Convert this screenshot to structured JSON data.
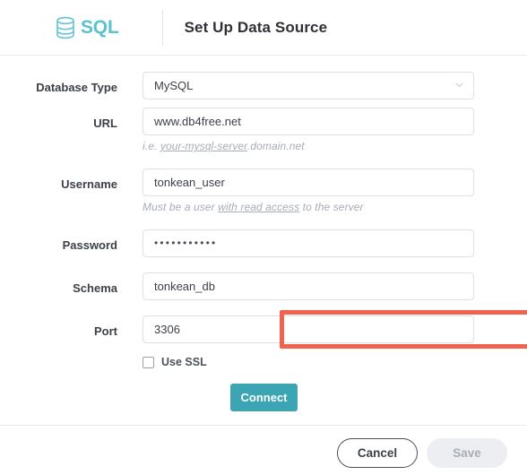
{
  "header": {
    "logo_text": "SQL",
    "logo_icon": "database-cylinder-icon",
    "title": "Set Up Data Source"
  },
  "form": {
    "fields": [
      {
        "label": "Database Type",
        "type": "select",
        "value": "MySQL",
        "icon": "chevron-down-icon",
        "hint": null,
        "highlighted": false
      },
      {
        "label": "URL",
        "type": "text",
        "value": "www.db4free.net",
        "hint_prefix": "i.e. ",
        "hint_underlined": "your-mysql-server",
        "hint_suffix": ".domain.net",
        "highlighted": false
      },
      {
        "label": "Username",
        "type": "text",
        "value": "tonkean_user",
        "hint_prefix": "Must be a user ",
        "hint_underlined": "with read access",
        "hint_suffix": " to the server",
        "highlighted": false
      },
      {
        "label": "Password",
        "type": "password",
        "value": "•••••••••••",
        "hint": null,
        "highlighted": false
      },
      {
        "label": "Schema",
        "type": "text",
        "value": "tonkean_db",
        "hint": null,
        "highlighted": false
      },
      {
        "label": "Port",
        "type": "text",
        "value": "3306",
        "hint": null,
        "highlighted": true
      }
    ],
    "ssl": {
      "label": "Use SSL",
      "checked": false
    },
    "connect_label": "Connect"
  },
  "footer": {
    "cancel_label": "Cancel",
    "save_label": "Save"
  },
  "colors": {
    "accent_teal": "#3ba5b4",
    "logo_teal": "#5bc0d0",
    "highlight_red": "#f0614e",
    "text_dark": "#3c4049",
    "hint_gray": "#a7acb5",
    "border_gray": "#dcdfe3"
  }
}
